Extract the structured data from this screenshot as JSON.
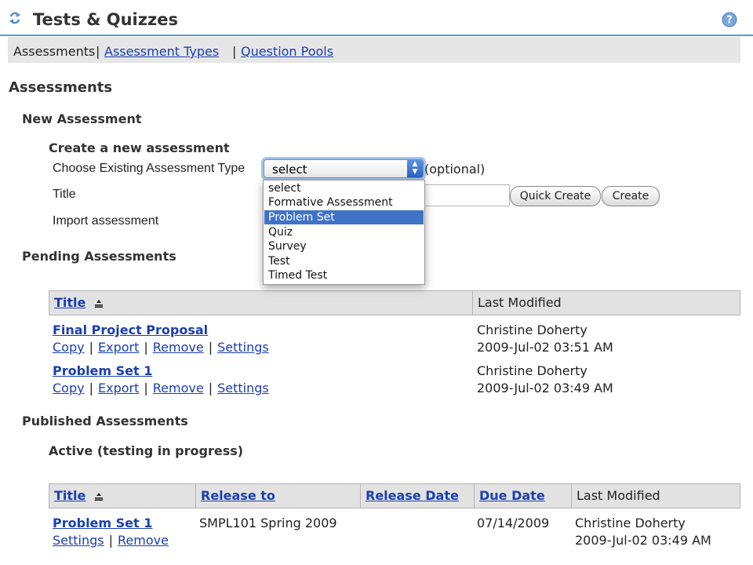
{
  "header": {
    "title": "Tests & Quizzes"
  },
  "nav": {
    "assessments": "Assessments",
    "sep1": "|",
    "assessment_types": "Assessment Types",
    "sep2": "|",
    "question_pools": "Question Pools"
  },
  "page_title": "Assessments",
  "new_assessment": {
    "heading": "New Assessment",
    "subheading": "Create a new assessment",
    "type_label": "Choose Existing Assessment Type",
    "type_selected": "select",
    "optional": "(optional)",
    "title_label": "Title",
    "import_label": "Import assessment",
    "quick_create": "Quick Create",
    "create": "Create",
    "type_options": [
      "select",
      "Formative Assessment",
      "Problem Set",
      "Quiz",
      "Survey",
      "Test",
      "Timed Test"
    ],
    "highlighted_option": "Problem Set"
  },
  "pending": {
    "heading": "Pending Assessments",
    "columns": [
      "Title",
      "Last Modified"
    ],
    "rows": [
      {
        "title": "Final Project Proposal",
        "modified_by": "Christine Doherty",
        "modified_at": "2009-Jul-02 03:51 AM",
        "actions": [
          "Copy",
          "Export",
          "Remove",
          "Settings"
        ]
      },
      {
        "title": "Problem Set 1",
        "modified_by": "Christine Doherty",
        "modified_at": "2009-Jul-02 03:49 AM",
        "actions": [
          "Copy",
          "Export",
          "Remove",
          "Settings"
        ]
      }
    ]
  },
  "published": {
    "heading": "Published Assessments",
    "active_heading": "Active (testing in progress)",
    "columns": [
      "Title",
      "Release to",
      "Release Date",
      "Due Date",
      "Last Modified"
    ],
    "rows": [
      {
        "title": "Problem Set 1",
        "release_to": "SMPL101 Spring 2009",
        "release_date": "",
        "due_date": "07/14/2009",
        "modified_by": "Christine Doherty",
        "modified_at": "2009-Jul-02 03:49 AM",
        "actions": [
          "Settings",
          "Remove"
        ]
      }
    ]
  },
  "colors": {
    "link": "#1a3fb0",
    "header_rule": "#5a9bc9",
    "nav_bg": "#e6e6e6",
    "table_header_bg": "#e2e2e2",
    "dropdown_highlight": "#3f73c8"
  },
  "icons": {
    "reset": "reset-arrows-icon",
    "help": "help-icon",
    "sort": "sort-icon",
    "select_arrows": "updown-arrows-icon"
  }
}
